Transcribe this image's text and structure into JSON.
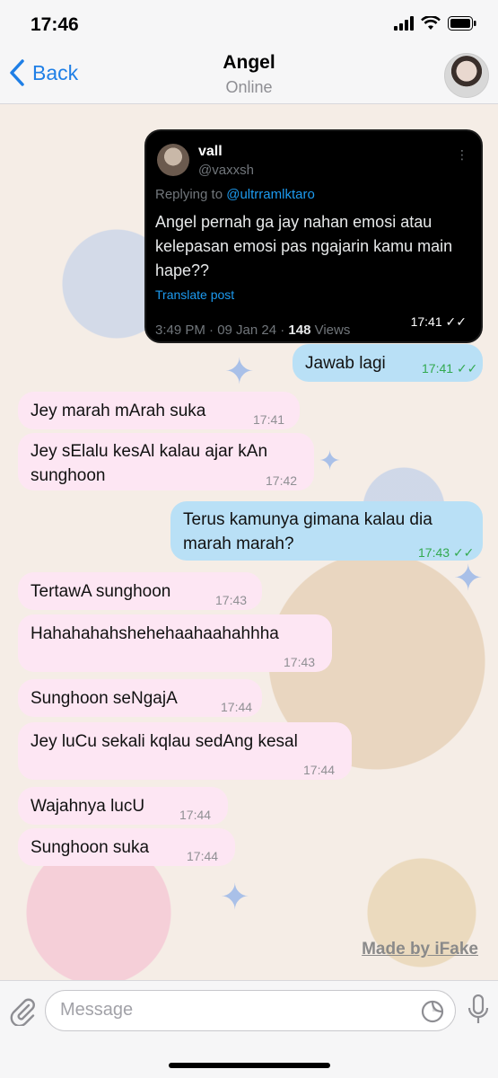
{
  "status": {
    "time": "17:46"
  },
  "header": {
    "back_label": "Back",
    "title": "Angel",
    "subtitle": "Online"
  },
  "tweet": {
    "name": "vall",
    "handle": "@vaxxsh",
    "replying_prefix": "Replying to ",
    "replying_to": "@ultrramlktaro",
    "text": "Angel pernah ga jay nahan emosi atau kelepasan emosi pas ngajarin kamu main hape??",
    "translate": "Translate post",
    "meta_prefix": "3:49 PM · 09 Jan 24 · ",
    "views_count": "148",
    "views_suffix": " Views",
    "time": "17:41"
  },
  "messages": [
    {
      "dir": "out",
      "text": "Jawab lagi",
      "time": "17:41"
    },
    {
      "dir": "in",
      "text": "Jey marah mArah suka",
      "time": "17:41"
    },
    {
      "dir": "in",
      "text": "Jey sElalu kesAl kalau ajar kAn sunghoon",
      "time": "17:42"
    },
    {
      "dir": "out",
      "text": "Terus kamunya gimana kalau dia marah marah?",
      "time": "17:43"
    },
    {
      "dir": "in",
      "text": "TertawA sunghoon",
      "time": "17:43"
    },
    {
      "dir": "in",
      "text": "Hahahahahshehehaahaahahhha",
      "time": "17:43"
    },
    {
      "dir": "in",
      "text": "Sunghoon seNgajA",
      "time": "17:44"
    },
    {
      "dir": "in",
      "text": "Jey luCu sekali kqlau sedAng kesal",
      "time": "17:44"
    },
    {
      "dir": "in",
      "text": "Wajahnya lucU",
      "time": "17:44"
    },
    {
      "dir": "in",
      "text": "Sunghoon suka",
      "time": "17:44"
    }
  ],
  "watermark": "Made by iFake",
  "composer": {
    "placeholder": "Message"
  },
  "colors": {
    "accent": "#1f7fe6",
    "incoming": "#fde6f3",
    "outgoing": "#b9e0f6",
    "read_check": "#32a94f"
  }
}
